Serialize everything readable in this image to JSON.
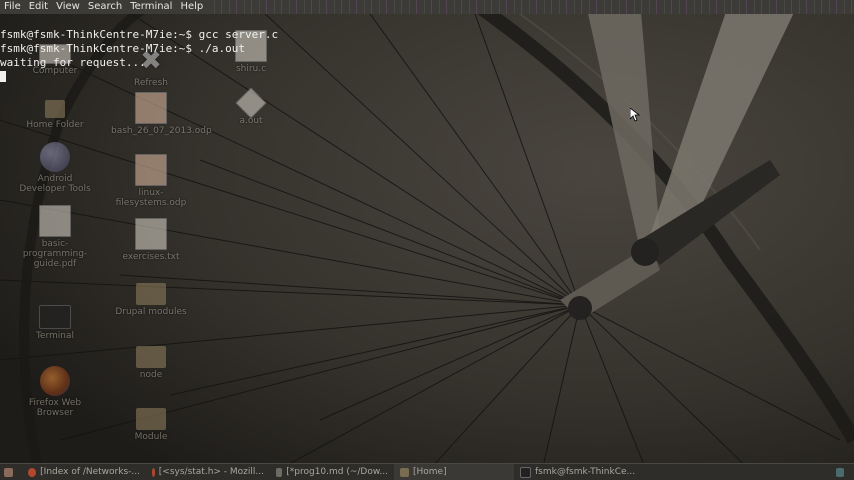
{
  "menubar": {
    "items": [
      "File",
      "Edit",
      "View",
      "Search",
      "Terminal",
      "Help"
    ]
  },
  "terminal": {
    "lines": [
      "fsmk@fsmk-ThinkCentre-M7ie:~$ gcc server.c",
      "fsmk@fsmk-ThinkCentre-M7ie:~$ ./a.out",
      "waiting for request..."
    ]
  },
  "desktop": {
    "icons": [
      {
        "label": "Computer",
        "icon": "computer-icon"
      },
      {
        "label": "Refresh",
        "icon": "close-icon"
      },
      {
        "label": "shiru.c",
        "icon": "text-file-icon"
      },
      {
        "label": "Home Folder",
        "icon": "home-folder-icon"
      },
      {
        "label": "bash_26_07_2013.odp",
        "icon": "presentation-icon"
      },
      {
        "label": "a.out",
        "icon": "executable-icon"
      },
      {
        "label": "Android Developer Tools",
        "icon": "eclipse-icon"
      },
      {
        "label": "linux-filesystems.odp",
        "icon": "presentation-icon"
      },
      {
        "label": "basic-programming-guide.pdf",
        "icon": "pdf-icon"
      },
      {
        "label": "exercises.txt",
        "icon": "text-file-icon"
      },
      {
        "label": "Drupal modules",
        "icon": "folder-icon"
      },
      {
        "label": "Terminal",
        "icon": "terminal-icon"
      },
      {
        "label": "node",
        "icon": "folder-icon"
      },
      {
        "label": "Firefox Web Browser",
        "icon": "firefox-icon"
      },
      {
        "label": "Module",
        "icon": "folder-icon"
      }
    ]
  },
  "taskbar": {
    "tasks": [
      {
        "label": "[Index of /Networks-...",
        "icon": "firefox-icon"
      },
      {
        "label": "[<sys/stat.h> - Mozill...",
        "icon": "firefox-icon"
      },
      {
        "label": "[*prog10.md (~/Dow...",
        "icon": "editor-icon"
      },
      {
        "label": "[Home]",
        "icon": "folder-icon"
      },
      {
        "label": "fsmk@fsmk-ThinkCe...",
        "icon": "terminal-icon"
      }
    ]
  },
  "colors": {
    "terminal_text": "#f0f0ee",
    "menubar_bg": "#3c3b37",
    "taskbar_bg": "#2e2d2a"
  }
}
